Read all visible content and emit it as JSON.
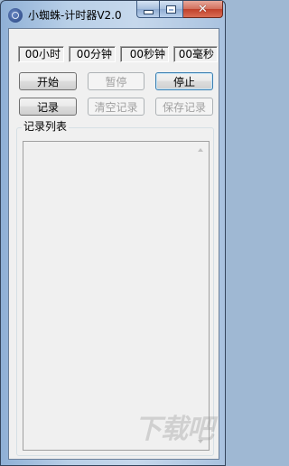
{
  "window": {
    "title": "小蜘蛛-计时器V2.0",
    "close_glyph": "✕"
  },
  "timer": {
    "hours": "00小时",
    "minutes": "00分钟",
    "seconds": "00秒钟",
    "milliseconds": "00毫秒"
  },
  "buttons": {
    "start": "开始",
    "pause": "暂停",
    "stop": "停止",
    "record": "记录",
    "clear_records": "清空记录",
    "save_records": "保存记录"
  },
  "records": {
    "group_label": "记录列表",
    "items": []
  },
  "watermark": "下载吧",
  "colors": {
    "title_bar": "#b8cfe7",
    "close_button": "#c0402a",
    "client_bg": "#f0f0f0",
    "default_button_border": "#3c7fb1",
    "disabled_text": "#a0a0a0"
  }
}
